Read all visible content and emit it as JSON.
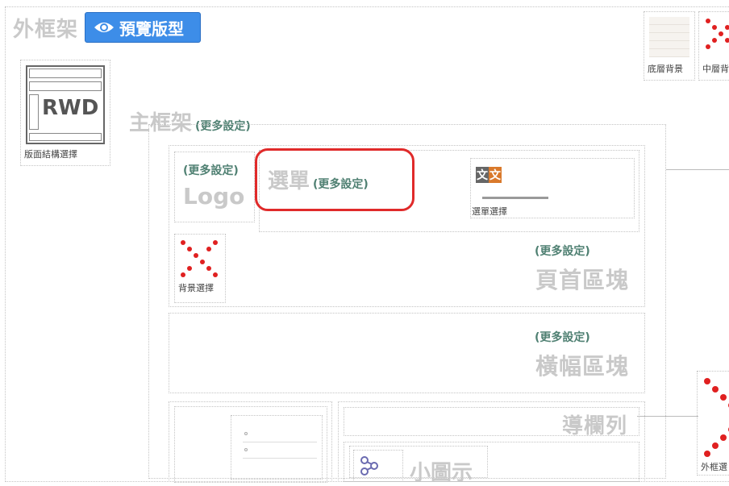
{
  "outer": {
    "title": "外框架",
    "preview_button": "預覽版型"
  },
  "layout_select": {
    "icon_text": "RWD",
    "label": "版面結構選擇"
  },
  "top_right": {
    "bottom_bg_label": "底層背景",
    "middle_bg_label": "中層背"
  },
  "main": {
    "title": "主框架",
    "more": "(更多設定)"
  },
  "logo": {
    "more": "(更多設定)",
    "text": "Logo"
  },
  "menu": {
    "title": "選單",
    "more": "(更多設定)",
    "select_label": "選單選擇",
    "icon_chars": [
      "文",
      "文"
    ]
  },
  "header": {
    "bg_select_label": "背景選擇",
    "more": "(更多設定)",
    "title": "頁首區塊"
  },
  "banner": {
    "more": "(更多設定)",
    "title": "橫幅區塊"
  },
  "nav": {
    "title": "導欄列"
  },
  "small_icon": {
    "title": "小圖示"
  },
  "outer_bg": {
    "label": "外框選"
  },
  "colors": {
    "accent": "#3d8de8",
    "highlight": "#e02a2a",
    "more_text": "#4f8072",
    "muted": "#c9c9c9"
  }
}
